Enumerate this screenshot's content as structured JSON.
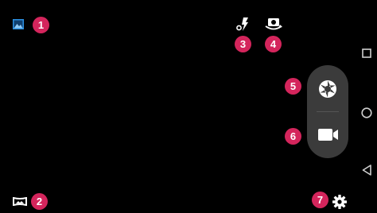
{
  "callouts": [
    {
      "id": "gallery",
      "number": "1",
      "icon": "gallery-icon"
    },
    {
      "id": "mode",
      "number": "2",
      "icon": "panorama-mode-icon"
    },
    {
      "id": "flash",
      "number": "3",
      "icon": "flash-auto-icon"
    },
    {
      "id": "switch-camera",
      "number": "4",
      "icon": "switch-camera-icon"
    },
    {
      "id": "shutter",
      "number": "5",
      "icon": "shutter-icon"
    },
    {
      "id": "record",
      "number": "6",
      "icon": "video-camera-icon"
    },
    {
      "id": "settings",
      "number": "7",
      "icon": "gear-icon"
    }
  ],
  "nav_bar": {
    "recent": "recent-apps-square-icon",
    "home": "home-circle-icon",
    "back": "back-triangle-icon"
  },
  "colors": {
    "background": "#000000",
    "badge": "#d4255c",
    "gallery_icon": "#2b8fe0",
    "panel": "#3b3b3b",
    "icon": "#ffffff",
    "nav": "#d0d0d0"
  }
}
